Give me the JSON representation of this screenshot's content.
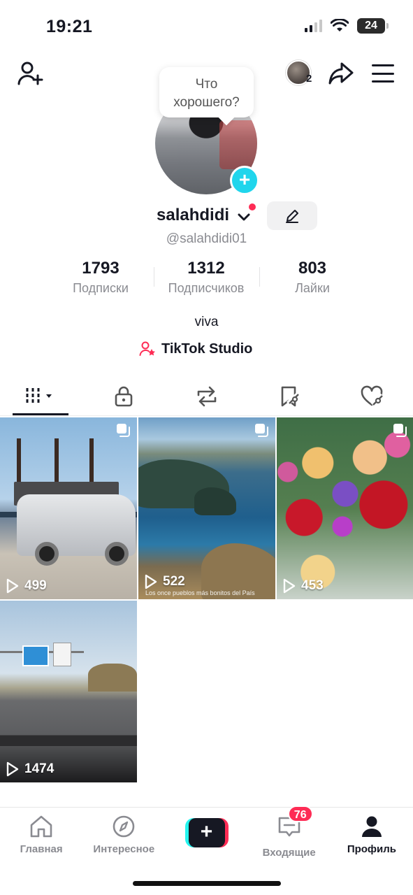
{
  "status_bar": {
    "time": "19:21",
    "battery": "24"
  },
  "header": {
    "avatar_count": "2"
  },
  "tooltip": {
    "line1": "Что",
    "line2": "хорошего?"
  },
  "profile": {
    "username": "salahdidi",
    "handle": "@salahdidi01",
    "bio": "viva",
    "studio_link": "TikTok Studio"
  },
  "stats": [
    {
      "value": "1793",
      "label": "Подписки"
    },
    {
      "value": "1312",
      "label": "Подписчиков"
    },
    {
      "value": "803",
      "label": "Лайки"
    }
  ],
  "tabs": [
    "videos-grid-icon",
    "lock-icon",
    "repost-icon",
    "bookmark-icon",
    "liked-icon"
  ],
  "videos": [
    {
      "views": "499",
      "multi": true
    },
    {
      "views": "522",
      "multi": true,
      "caption": "Los once pueblos más bonitos del País"
    },
    {
      "views": "453",
      "multi": true
    },
    {
      "views": "1474",
      "multi": false
    }
  ],
  "nav": {
    "home": "Главная",
    "discover": "Интересное",
    "inbox": "Входящие",
    "inbox_badge": "76",
    "profile": "Профиль"
  },
  "colors": {
    "accent": "#fe2c55",
    "cyan": "#25f4ee",
    "text": "#161823",
    "muted": "#8a8b91"
  }
}
